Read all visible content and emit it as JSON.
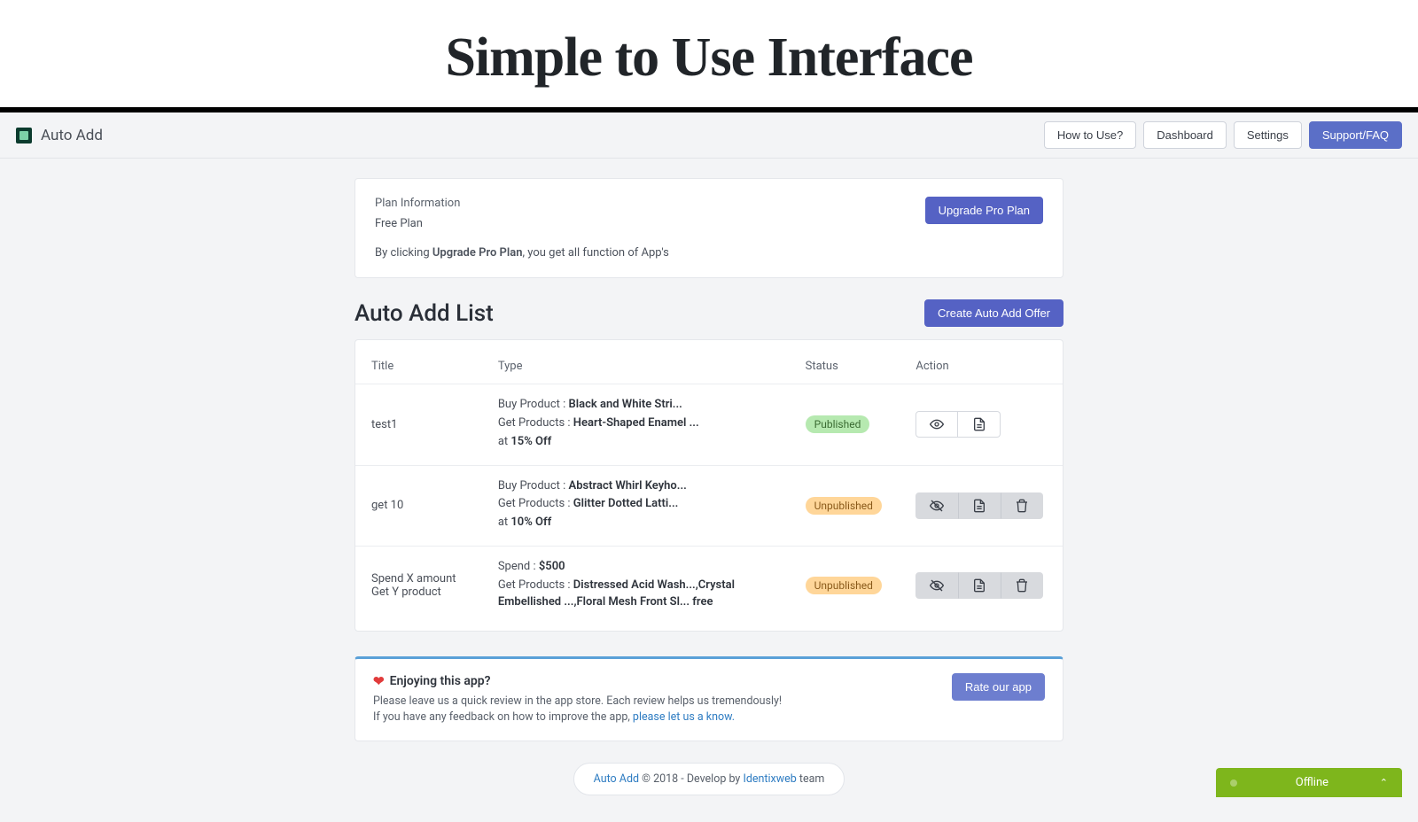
{
  "hero": {
    "title": "Simple to Use Interface"
  },
  "brand": {
    "name": "Auto Add"
  },
  "nav": {
    "how_to_use": "How to Use?",
    "dashboard": "Dashboard",
    "settings": "Settings",
    "support": "Support/FAQ"
  },
  "plan": {
    "label": "Plan Information",
    "value": "Free Plan",
    "note_pre": "By clicking ",
    "note_strong": "Upgrade Pro Plan",
    "note_post": ", you get all function of App's",
    "upgrade_btn": "Upgrade Pro Plan"
  },
  "list": {
    "heading": "Auto Add List",
    "create_btn": "Create Auto Add Offer",
    "columns": {
      "title": "Title",
      "type": "Type",
      "status": "Status",
      "action": "Action"
    },
    "status_labels": {
      "published": "Published",
      "unpublished": "Unpublished"
    },
    "rows": [
      {
        "title": "test1",
        "type_lines": [
          {
            "pre": "Buy Product : ",
            "strong": "Black and White Stri..."
          },
          {
            "pre": "Get Products : ",
            "strong": "Heart-Shaped Enamel ..."
          },
          {
            "pre": "at ",
            "strong": "15% Off"
          }
        ],
        "status": "published",
        "actions_variant": "light",
        "actions": [
          "eye",
          "doc"
        ]
      },
      {
        "title": "get 10",
        "type_lines": [
          {
            "pre": "Buy Product : ",
            "strong": "Abstract Whirl Keyho..."
          },
          {
            "pre": "Get Products : ",
            "strong": "Glitter Dotted Latti..."
          },
          {
            "pre": "at ",
            "strong": "10% Off"
          }
        ],
        "status": "unpublished",
        "actions_variant": "dark",
        "actions": [
          "eye-off",
          "doc",
          "trash"
        ]
      },
      {
        "title": "Spend X amount Get Y product",
        "type_lines": [
          {
            "pre": "Spend : ",
            "strong": "$500"
          },
          {
            "pre": "Get Products : ",
            "strong": "Distressed Acid Wash...,Crystal Embellished ...,Floral Mesh Front Sl... free"
          }
        ],
        "status": "unpublished",
        "actions_variant": "dark",
        "actions": [
          "eye-off",
          "doc",
          "trash"
        ]
      }
    ]
  },
  "review": {
    "title": "Enjoying this app?",
    "line1": "Please leave us a quick review in the app store. Each review helps us tremendously!",
    "line2_pre": "If you have any feedback on how to improve the app, ",
    "line2_link": "please let us a know.",
    "rate_btn": "Rate our app"
  },
  "footer": {
    "brand": "Auto Add",
    "mid": " © 2018 - Develop by ",
    "dev": "Identixweb",
    "tail": " team"
  },
  "chat": {
    "label": "Offline"
  }
}
